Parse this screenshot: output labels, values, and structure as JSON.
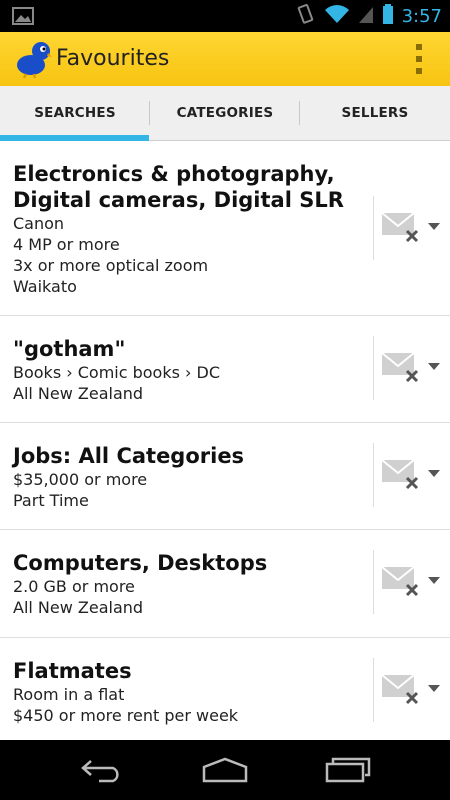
{
  "status_bar": {
    "time": "3:57",
    "icons": [
      "picture-icon",
      "vibrate-icon",
      "wifi-icon",
      "signal-icon",
      "battery-icon"
    ]
  },
  "action_bar": {
    "title": "Favourites",
    "logo_icon": "kiwi-bird-logo",
    "overflow_icon": "overflow-menu-icon",
    "background_color": "#f7c411"
  },
  "tabs": [
    {
      "label": "SEARCHES",
      "active": true
    },
    {
      "label": "CATEGORIES",
      "active": false
    },
    {
      "label": "SELLERS",
      "active": false
    }
  ],
  "accent_color": "#33b5e5",
  "favourites": [
    {
      "title": "Electronics & photography, Digital cameras, Digital SLR",
      "details": [
        "Canon",
        "4 MP or more",
        "3x or more optical zoom",
        "Waikato"
      ],
      "action_icon": "email-off-icon"
    },
    {
      "title": "\"gotham\"",
      "details": [
        "Books › Comic books › DC",
        "All New Zealand"
      ],
      "action_icon": "email-off-icon"
    },
    {
      "title": "Jobs: All Categories",
      "details": [
        "$35,000 or more",
        "Part Time"
      ],
      "action_icon": "email-off-icon"
    },
    {
      "title": "Computers, Desktops",
      "details": [
        "2.0 GB or more",
        "All New Zealand"
      ],
      "action_icon": "email-off-icon"
    },
    {
      "title": "Flatmates",
      "details": [
        "Room in a flat",
        "$450 or more rent per week"
      ],
      "action_icon": "email-off-icon"
    }
  ],
  "nav_bar": {
    "buttons": [
      "back-icon",
      "home-icon",
      "recent-apps-icon"
    ]
  }
}
